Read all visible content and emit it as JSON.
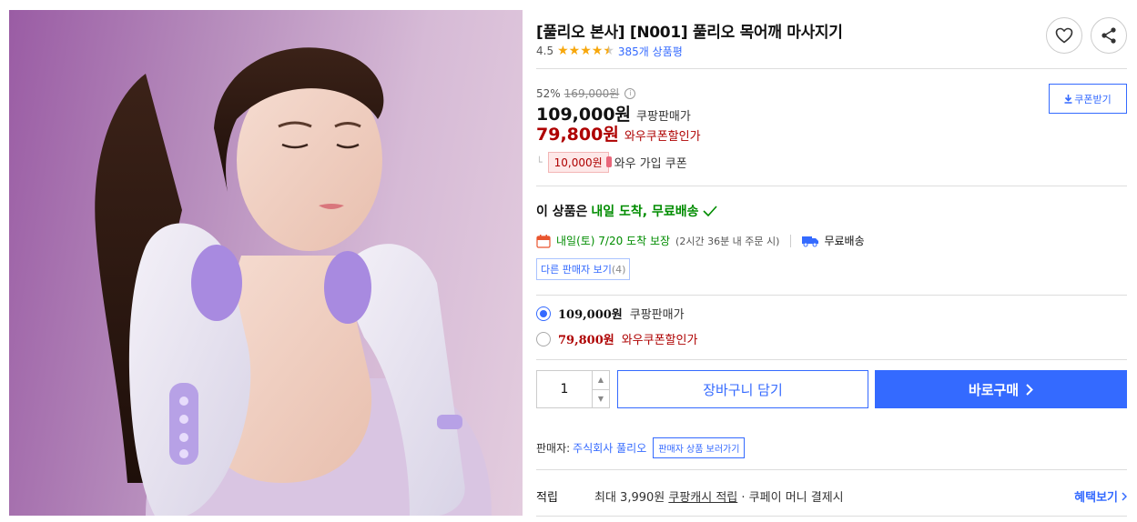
{
  "product": {
    "title": "[풀리오 본사] [N001] 풀리오 목어깨 마사지기",
    "rating": "4.5",
    "review_count": "385개 상품평"
  },
  "pricing": {
    "discount_rate": "52%",
    "original_price": "169,000원",
    "sale_price": "109,000원",
    "sale_label": "쿠팡판매가",
    "wow_price": "79,800원",
    "wow_label": "와우쿠폰할인가",
    "coupon_amount": "10,000원",
    "coupon_label": "와우 가입 쿠폰",
    "coupon_download_label": "쿠폰받기"
  },
  "delivery": {
    "headline_prefix": "이 상품은 ",
    "headline_highlight": "내일 도착, 무료배송",
    "arrival_text": "내일(토) 7/20 도착 보장",
    "deadline_text": "(2시간 36분 내 주문 시)",
    "shipping_text": "무료배송",
    "other_sellers_label": "다른 판매자 보기",
    "other_sellers_count": "(4)"
  },
  "options": [
    {
      "amount": "109,000원",
      "label": "쿠팡판매가",
      "selected": true
    },
    {
      "amount": "79,800원",
      "label": "와우쿠폰할인가",
      "selected": false
    }
  ],
  "purchase": {
    "quantity": "1",
    "cart_label": "장바구니 담기",
    "buy_label": "바로구매"
  },
  "seller": {
    "label": "판매자:",
    "name": "주식회사 풀리오",
    "store_link_label": "판매자 상품 보러가기"
  },
  "reward": {
    "label": "적립",
    "text_prefix": "최대 3,990원 ",
    "text_link": "쿠팡캐시 적립",
    "text_suffix": " · 쿠페이 머니 결제시",
    "more_label": "혜택보기"
  },
  "colors": {
    "accent": "#346aff",
    "wow_red": "#ae0000",
    "delivery_green": "#008c00",
    "star": "#f7a70c"
  },
  "icons": [
    "heart-icon",
    "share-icon",
    "download-icon",
    "info-icon",
    "calendar-icon",
    "truck-icon",
    "check-icon",
    "chevron-right-icon",
    "star-icon"
  ]
}
